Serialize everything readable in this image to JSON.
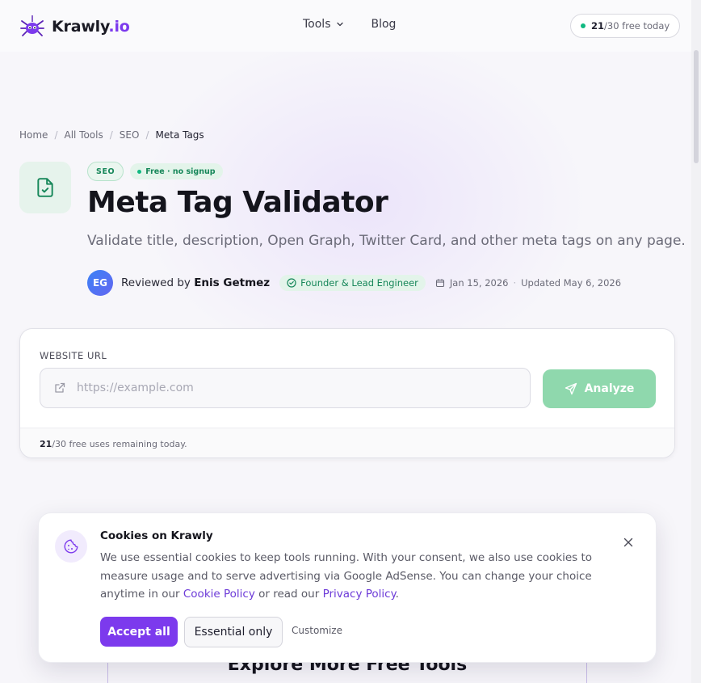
{
  "header": {
    "brand_name": "Krawly",
    "brand_suffix": ".io",
    "nav": [
      {
        "label": "Tools",
        "icon": "chevron-down-icon"
      },
      {
        "label": "Blog"
      }
    ],
    "usage": {
      "used": "21",
      "rest": "/30 free today"
    }
  },
  "breadcrumb": {
    "items": [
      "Home",
      "All Tools",
      "SEO"
    ],
    "current": "Meta Tags",
    "separator": "/"
  },
  "hero": {
    "category_badge": "SEO",
    "free_badge": "Free · no signup",
    "title": "Meta Tag Validator",
    "subtitle": "Validate title, description, Open Graph, Twitter Card, and other meta tags on any page.",
    "reviewer": {
      "initials": "EG",
      "prefix": "Reviewed by",
      "name": "Enis Getmez",
      "role": "Founder & Lead Engineer",
      "published": "Jan 15, 2026",
      "separator": "·",
      "updated": "Updated May 6, 2026"
    }
  },
  "tool_form": {
    "field_label": "WEBSITE URL",
    "url_value": "",
    "url_placeholder": "https://example.com",
    "analyze_label": "Analyze",
    "footer_count": "21",
    "footer_text": "/30 free uses remaining today."
  },
  "explore": {
    "title": "Explore More Free Tools"
  },
  "cookie_banner": {
    "title": "Cookies on Krawly",
    "text": "We use essential cookies to keep tools running. With your consent, we also use cookies to measure usage and to serve advertising via Google AdSense. You can change your choice anytime in our",
    "cookie_policy_link": "Cookie Policy",
    "connector": "or read our",
    "privacy_policy_link": "Privacy Policy",
    "end": ".",
    "accept_label": "Accept all",
    "essential_label": "Essential only",
    "customize_label": "Customize"
  },
  "colors": {
    "brand": "#7c3aed",
    "success": "#10b981",
    "analyze_button": "#8fd8ad"
  }
}
